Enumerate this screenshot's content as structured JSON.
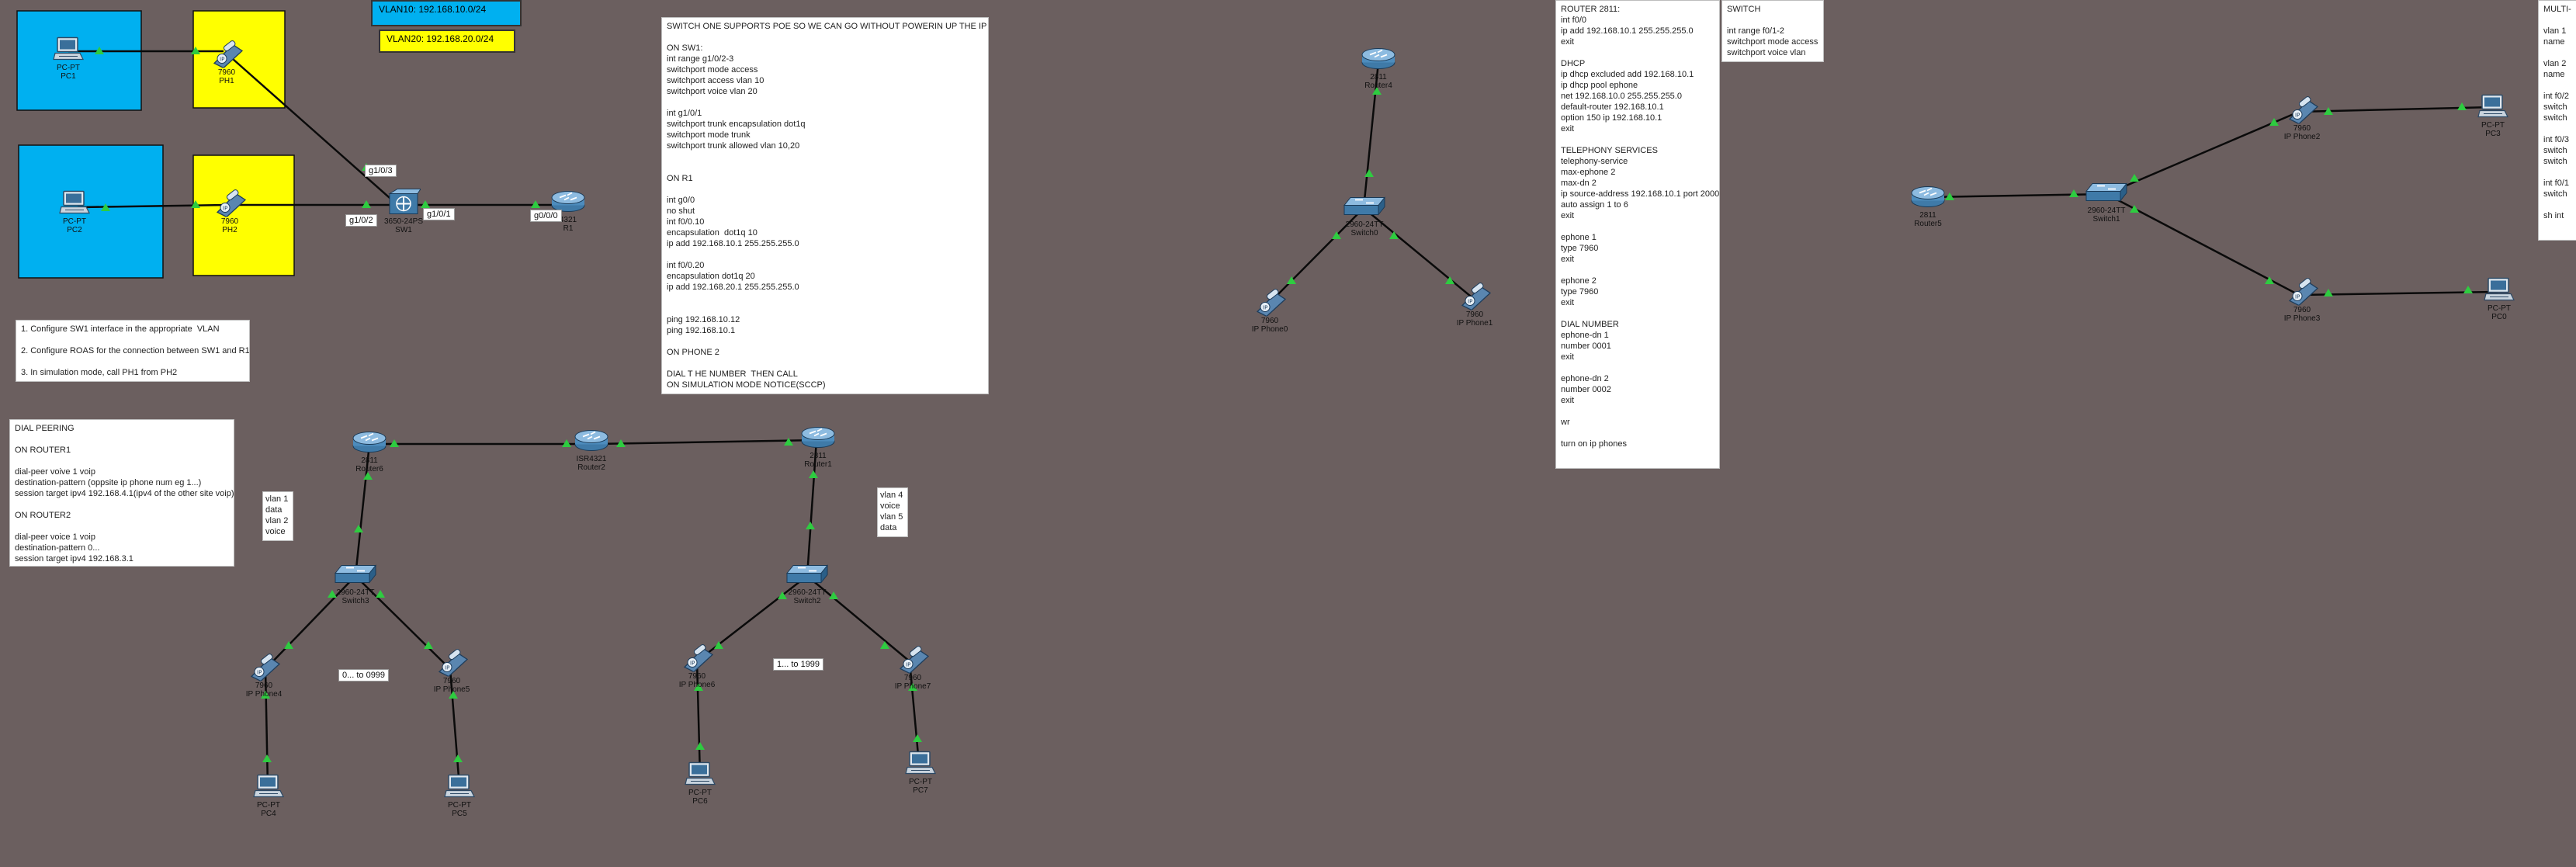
{
  "colors": {
    "background": "#6b5f5f",
    "blue_area": "#00b0f0",
    "yellow_area": "#ffff00",
    "link": "#0a0a0a",
    "port_dot": "#2ecc40"
  },
  "vlan_labels": {
    "vlan10": "VLAN10: 192.168.10.0/24",
    "vlan20": "VLAN20: 192.168.20.0/24"
  },
  "notes": {
    "switch_one": "SWITCH ONE SUPPORTS POE SO WE CAN GO WITHOUT POWERIN UP THE IP PHONE\n\nON SW1:\nint range g1/0/2-3\nswitchport mode access\nswitchport access vlan 10\nswitchport voice vlan 20\n\nint g1/0/1\nswitchport trunk encapsulation dot1q\nswitchport mode trunk\nswitchport trunk allowed vlan 10,20\n\n\nON R1\n\nint g0/0\nno shut\nint f0/0.10\nencapsulation  dot1q 10\nip add 192.168.10.1 255.255.255.0\n\nint f0/0.20\nencapsulation dot1q 20\nip add 192.168.20.1 255.255.255.0\n\n\nping 192.168.10.12\nping 192.168.10.1\n\nON PHONE 2\n\nDIAL T HE NUMBER  THEN CALL\nON SIMULATION MODE NOTICE(SCCP)",
    "tasks": "1. Configure SW1 interface in the appropriate  VLAN\n\n2. Configure ROAS for the connection between SW1 and R1\n\n3. In simulation mode, call PH1 from PH2",
    "dial_peering": "DIAL PEERING\n\nON ROUTER1\n\ndial-peer voive 1 voip\ndestination-pattern (oppsite ip phone num eg 1...)\nsession target ipv4 192.168.4.1(ipv4 of the other site voip)\n\nON ROUTER2\n\ndial-peer voice 1 voip\ndestination-pattern 0...\nsession target ipv4 192.168.3.1",
    "router2811": "ROUTER 2811:\nint f0/0\nip add 192.168.10.1 255.255.255.0\nexit\n\nDHCP\nip dhcp excluded add 192.168.10.1\nip dhcp pool ephone\nnet 192.168.10.0 255.255.255.0\ndefault-router 192.168.10.1\noption 150 ip 192.168.10.1\nexit\n\nTELEPHONY SERVICES\ntelephony-service\nmax-ephone 2\nmax-dn 2\nip source-address 192.168.10.1 port 2000\nauto assign 1 to 6\nexit\n\nephone 1\ntype 7960\nexit\n\nephone 2\ntype 7960\nexit\n\nDIAL NUMBER\nephone-dn 1\nnumber 0001\nexit\n\nephone-dn 2\nnumber 0002\nexit\n\nwr\n\nturn on ip phones",
    "switch_small": "SWITCH\n\nint range f0/1-2\nswitchport mode access\nswitchport voice vlan",
    "multi_cut": "MULTI-\n\nvlan 1\nname \n\nvlan 2\nname \n\nint f0/2\nswitch\nswitch\n\nint f0/3\nswitch\nswitch\n\nint f0/1\nswitch\n\nsh int"
  },
  "small_labels": {
    "vlan_info_left": "vlan 1\ndata\nvlan 2\nvoice",
    "vlan_info_right": "vlan 4\nvoice\nvlan 5\ndata",
    "range_left": "0... to 0999",
    "range_right": "1... to 1999"
  },
  "port_labels": {
    "g103": "g1/0/3",
    "g102": "g1/0/2",
    "g101": "g1/0/1",
    "g000": "g0/0/0"
  },
  "devices": {
    "pc1": {
      "model": "PC-PT",
      "name": "PC1"
    },
    "ph1": {
      "model": "7960",
      "name": "PH1"
    },
    "pc2": {
      "model": "PC-PT",
      "name": "PC2"
    },
    "ph2": {
      "model": "7960",
      "name": "PH2"
    },
    "sw1": {
      "model": "3650-24PS",
      "name": "SW1"
    },
    "r1": {
      "model": "4321",
      "name": "R1"
    },
    "router6": {
      "model": "2811",
      "name": "Router6"
    },
    "router2": {
      "model": "ISR4321",
      "name": "Router2"
    },
    "router1": {
      "model": "2811",
      "name": "Router1"
    },
    "switch3": {
      "model": "2960-24TT",
      "name": "Switch3"
    },
    "switch2": {
      "model": "2960-24TT",
      "name": "Switch2"
    },
    "ipphone4": {
      "model": "7960",
      "name": "IP Phone4"
    },
    "ipphone5": {
      "model": "7960",
      "name": "IP Phone5"
    },
    "ipphone6": {
      "model": "7960",
      "name": "IP Phone6"
    },
    "ipphone7": {
      "model": "7960",
      "name": "IP Phone7"
    },
    "pc4": {
      "model": "PC-PT",
      "name": "PC4"
    },
    "pc5": {
      "model": "PC-PT",
      "name": "PC5"
    },
    "pc6": {
      "model": "PC-PT",
      "name": "PC6"
    },
    "pc7": {
      "model": "PC-PT",
      "name": "PC7"
    },
    "router4": {
      "model": "2811",
      "name": "Router4"
    },
    "switch0": {
      "model": "2960-24TT",
      "name": "Switch0"
    },
    "phone0": {
      "model": "7960",
      "name": "IP Phone0"
    },
    "phone1": {
      "model": "7960",
      "name": "IP Phone1"
    },
    "router5": {
      "model": "2811",
      "name": "Router5"
    },
    "switch1": {
      "model": "2960-24TT",
      "name": "Switch1"
    },
    "phone2": {
      "model": "7960",
      "name": "IP Phone2"
    },
    "phone3": {
      "model": "7960",
      "name": "IP Phone3"
    },
    "pc3": {
      "model": "PC-PT",
      "name": "PC3"
    },
    "pc0": {
      "model": "PC-PT",
      "name": "PC0"
    }
  }
}
